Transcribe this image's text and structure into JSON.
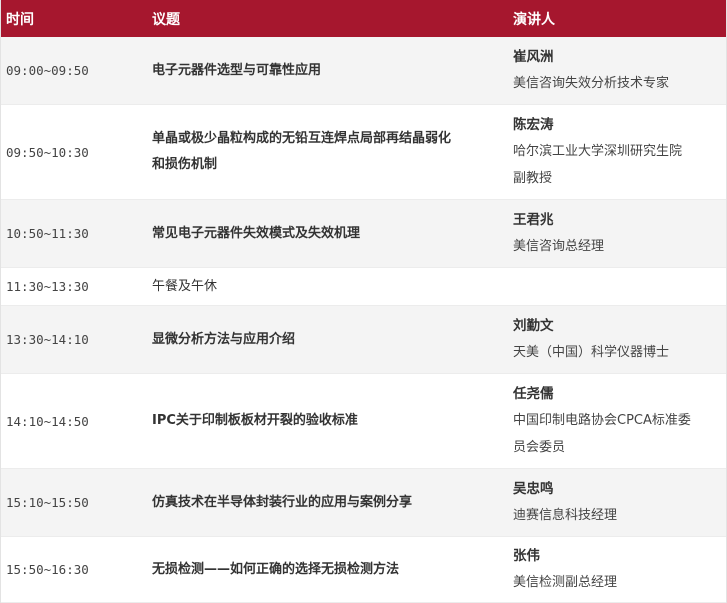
{
  "header": {
    "time": "时间",
    "topic": "议题",
    "speaker": "演讲人"
  },
  "rows": [
    {
      "time": "09:00~09:50",
      "topic_lines": [
        "电子元器件选型与可靠性应用"
      ],
      "speaker_name": "崔风洲",
      "speaker_title_lines": [
        "美信咨询失效分析技术专家"
      ]
    },
    {
      "time": "09:50~10:30",
      "topic_lines": [
        "单晶或极少晶粒构成的无铅互连焊点局部再结晶弱化",
        "和损伤机制"
      ],
      "speaker_name": "陈宏涛",
      "speaker_title_lines": [
        "哈尔滨工业大学深圳研究生院",
        "副教授"
      ]
    },
    {
      "time": "10:50~11:30",
      "topic_lines": [
        "常见电子元器件失效模式及失效机理"
      ],
      "speaker_name": "王君兆",
      "speaker_title_lines": [
        "美信咨询总经理"
      ]
    },
    {
      "time": "11:30~13:30",
      "topic_lines": [
        "午餐及午休"
      ],
      "speaker_name": "",
      "speaker_title_lines": []
    },
    {
      "time": "13:30~14:10",
      "topic_lines": [
        "显微分析方法与应用介绍"
      ],
      "speaker_name": "刘勤文",
      "speaker_title_lines": [
        "天美（中国）科学仪器博士"
      ]
    },
    {
      "time": "14:10~14:50",
      "topic_lines": [
        "IPC关于印制板板材开裂的验收标准"
      ],
      "speaker_name": "任尧儒",
      "speaker_title_lines": [
        "中国印制电路协会CPCA标准委",
        "员会委员"
      ]
    },
    {
      "time": "15:10~15:50",
      "topic_lines": [
        "仿真技术在半导体封装行业的应用与案例分享"
      ],
      "speaker_name": "吴忠鸣",
      "speaker_title_lines": [
        "迪赛信息科技经理"
      ]
    },
    {
      "time": "15:50~16:30",
      "topic_lines": [
        "无损检测——如何正确的选择无损检测方法"
      ],
      "speaker_name": "张伟",
      "speaker_title_lines": [
        "美信检测副总经理"
      ]
    }
  ],
  "colors": {
    "header_bg": "#a6172e",
    "header_text": "#ffffff",
    "alt_row_bg": "#f4f4f4"
  }
}
